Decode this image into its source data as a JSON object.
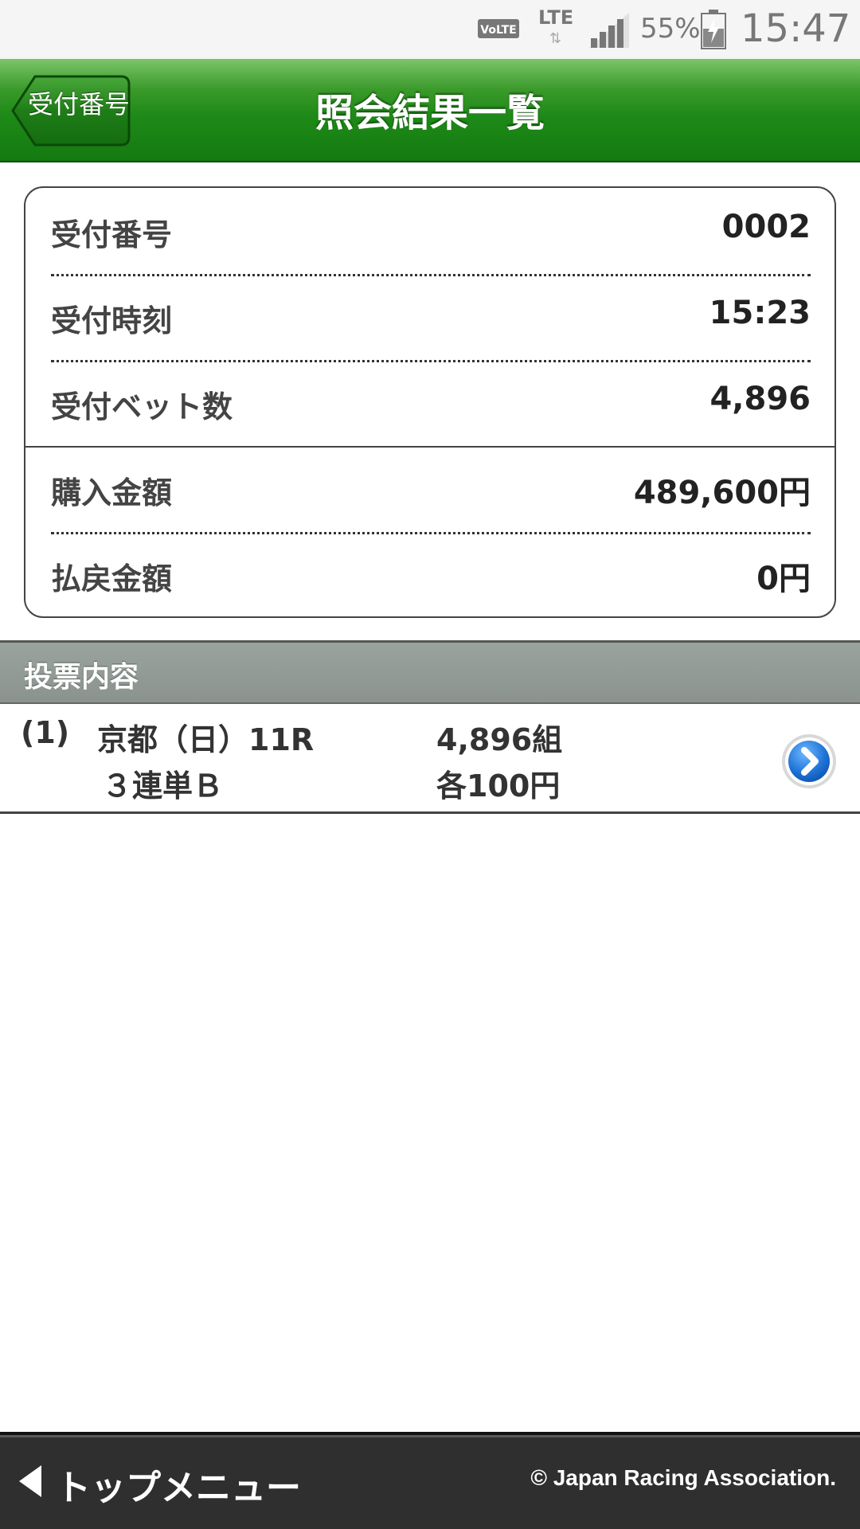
{
  "status_bar": {
    "volte": "VoLTE",
    "network": "LTE",
    "network_arrows": "⇅",
    "battery_percent": "55%",
    "time": "15:47",
    "icons": [
      "volte-icon",
      "lte-icon",
      "signal-icon",
      "battery-icon"
    ]
  },
  "header": {
    "back_label": "受付番号",
    "title": "照会結果一覧",
    "colors": {
      "bar": "#1f8a18",
      "back_button": "#1d7a15"
    }
  },
  "receipt": {
    "rows": [
      {
        "label": "受付番号",
        "value": "0002"
      },
      {
        "label": "受付時刻",
        "value": "15:23"
      },
      {
        "label": "受付ベット数",
        "value": "4,896"
      },
      {
        "label": "購入金額",
        "value": "489,600円"
      },
      {
        "label": "払戻金額",
        "value": "0円"
      }
    ]
  },
  "votes": {
    "section_title": "投票内容",
    "items": [
      {
        "index": "(1)",
        "race": "京都（日）11R",
        "bet_type": "３連単Ｂ",
        "combinations": "4,896組",
        "unit_amount": "各100円",
        "icon": "chevron-right-circle-icon"
      }
    ]
  },
  "footer": {
    "top_menu_label": "トップメニュー",
    "copyright": "© Japan Racing Association."
  }
}
